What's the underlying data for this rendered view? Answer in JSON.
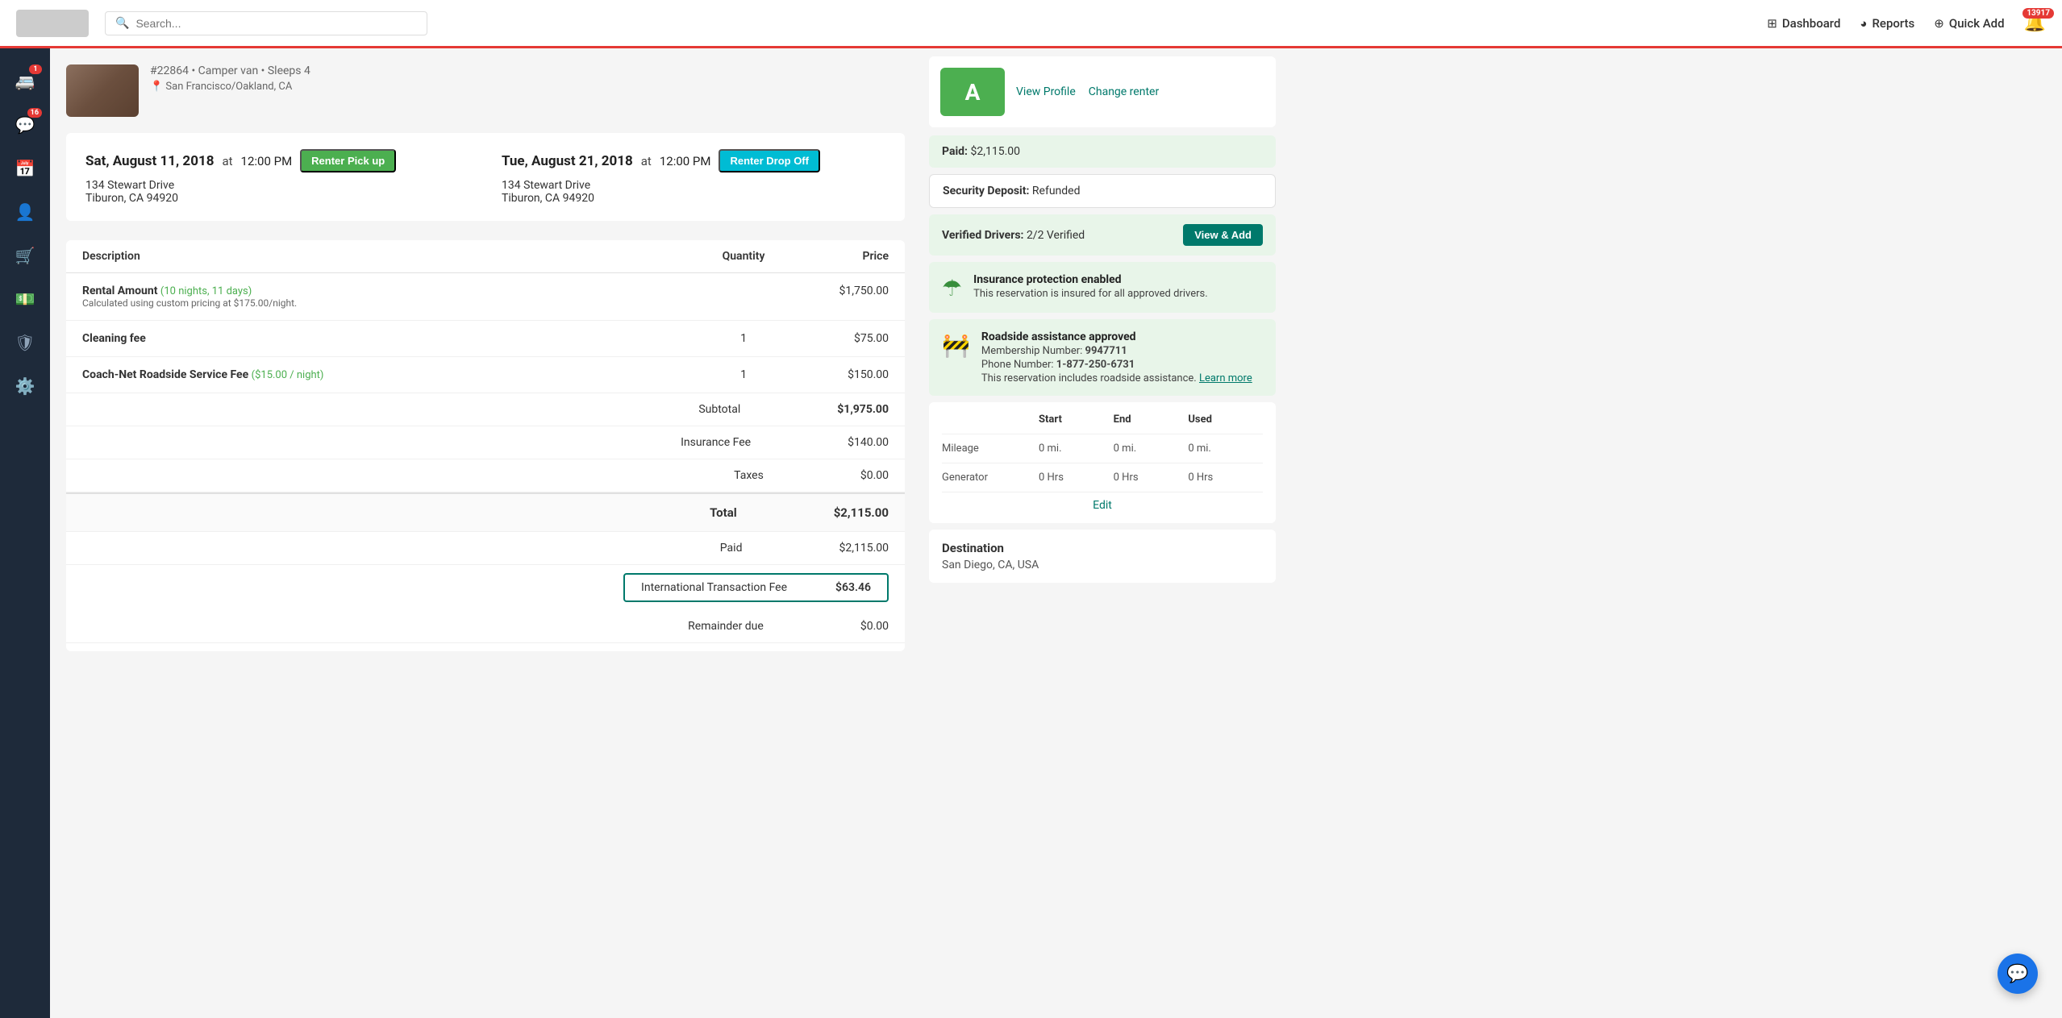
{
  "nav": {
    "logo_alt": "Logo",
    "search_placeholder": "Search...",
    "dashboard_label": "Dashboard",
    "reports_label": "Reports",
    "quick_add_label": "Quick Add",
    "bell_count": "13917"
  },
  "sidebar": {
    "items": [
      {
        "id": "vehicles",
        "icon": "🚐",
        "badge": "1"
      },
      {
        "id": "messages",
        "icon": "💬",
        "badge": "16"
      },
      {
        "id": "calendar",
        "icon": "📅",
        "badge": null
      },
      {
        "id": "users",
        "icon": "👤",
        "badge": null
      },
      {
        "id": "shop",
        "icon": "🛒",
        "badge": null
      },
      {
        "id": "payments",
        "icon": "💰",
        "badge": null
      },
      {
        "id": "shield",
        "icon": "🛡",
        "badge": null
      },
      {
        "id": "settings",
        "icon": "⚙",
        "badge": null
      }
    ]
  },
  "vehicle": {
    "id": "#22864",
    "type": "Camper van",
    "sleeps": "Sleeps 4",
    "location": "San Francisco/Oakland, CA"
  },
  "pickup": {
    "date": "Sat, August 11, 2018",
    "at": "at",
    "time": "12:00 PM",
    "label": "Renter Pick up",
    "address_line1": "134 Stewart Drive",
    "address_line2": "Tiburon, CA 94920"
  },
  "dropoff": {
    "date": "Tue, August 21, 2018",
    "at": "at",
    "time": "12:00 PM",
    "label": "Renter Drop Off",
    "address_line1": "134 Stewart Drive",
    "address_line2": "Tiburon, CA 94920"
  },
  "invoice": {
    "headers": [
      "Description",
      "Quantity",
      "Price"
    ],
    "rows": [
      {
        "desc": "Rental Amount",
        "nights_label": "(10 nights, 11 days)",
        "sub": "Calculated using custom pricing at $175.00/night.",
        "qty": "",
        "price": "$1,750.00"
      },
      {
        "desc": "Cleaning fee",
        "nights_label": "",
        "sub": "",
        "qty": "1",
        "price": "$75.00"
      },
      {
        "desc": "Coach-Net Roadside Service Fee",
        "nights_label": "($15.00 / night)",
        "sub": "",
        "qty": "1",
        "price": "$150.00"
      }
    ],
    "subtotal_label": "Subtotal",
    "subtotal_val": "$1,975.00",
    "insurance_label": "Insurance Fee",
    "insurance_val": "$140.00",
    "taxes_label": "Taxes",
    "taxes_val": "$0.00",
    "total_label": "Total",
    "total_val": "$2,115.00",
    "paid_label": "Paid",
    "paid_val": "$2,115.00",
    "intl_fee_label": "International Transaction Fee",
    "intl_fee_val": "$63.46",
    "remainder_label": "Remainder due",
    "remainder_val": "$0.00"
  },
  "right_panel": {
    "profile_initial": "A",
    "view_profile": "View Profile",
    "change_renter": "Change renter",
    "paid_label": "Paid:",
    "paid_val": "$2,115.00",
    "security_label": "Security Deposit:",
    "security_val": "Refunded",
    "verified_label": "Verified Drivers:",
    "verified_val": "2/2 Verified",
    "view_add_label": "View & Add",
    "insurance_title": "Insurance protection enabled",
    "insurance_desc": "This reservation is insured for all approved drivers.",
    "roadside_title": "Roadside assistance approved",
    "roadside_membership": "Membership Number:",
    "roadside_membership_val": "9947711",
    "roadside_phone_label": "Phone Number:",
    "roadside_phone_val": "1-877-250-6731",
    "roadside_desc": "This reservation includes roadside assistance.",
    "roadside_learn": "Learn more",
    "mileage_headers": [
      "",
      "Start",
      "End",
      "Used"
    ],
    "mileage_row1": {
      "label": "Mileage",
      "start": "0 mi.",
      "end": "0 mi.",
      "used": "0 mi."
    },
    "mileage_row2": {
      "label": "Generator",
      "start": "0 Hrs",
      "end": "0 Hrs",
      "used": "0 Hrs"
    },
    "edit_label": "Edit",
    "destination_title": "Destination",
    "destination_loc": "San Diego, CA, USA"
  }
}
